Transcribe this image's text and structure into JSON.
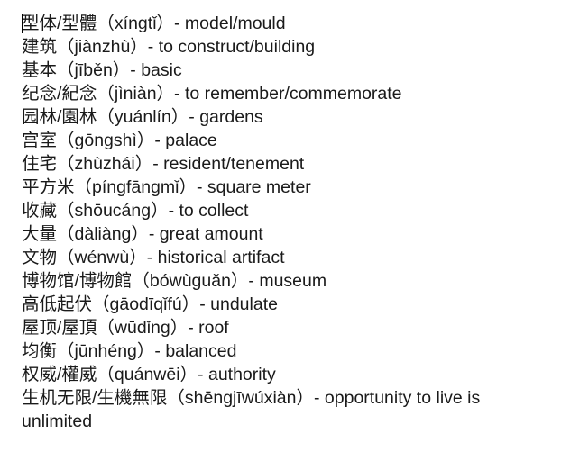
{
  "lines": [
    "型体/型體（xíngtǐ）- model/mould",
    "建筑（jiànzhù）- to construct/building",
    "基本（jīběn）- basic",
    "纪念/紀念（jìniàn）- to remember/commemorate",
    "园林/園林（yuánlín）- gardens",
    "宫室（gōngshì）- palace",
    "住宅（zhùzhái）- resident/tenement",
    "平方米（píngfāngmǐ）- square meter",
    "收藏（shōucáng）- to collect",
    "大量（dàliàng）- great amount",
    "文物（wénwù）- historical artifact",
    "博物馆/博物館（bówùguǎn）- museum",
    "高低起伏（gāodīqǐfú）- undulate",
    "屋顶/屋頂（wūdǐng）- roof",
    "均衡（jūnhéng）- balanced",
    "权威/權威（quánwēi）- authority",
    "生机无限/生機無限（shēngjīwúxiàn）- opportunity to live is unlimited"
  ]
}
